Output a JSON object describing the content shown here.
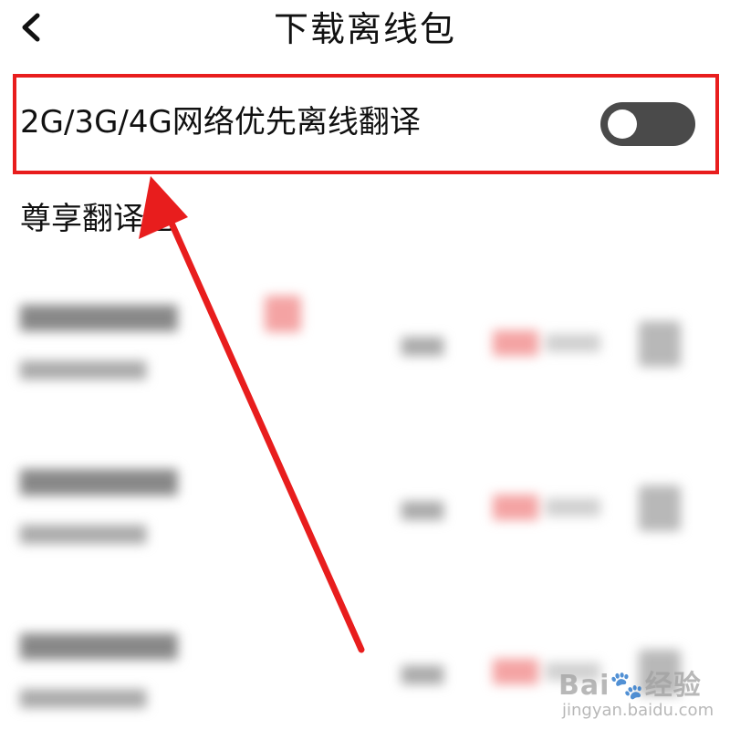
{
  "header": {
    "title": "下载离线包",
    "back_icon": "chevron-left-icon"
  },
  "offline_setting": {
    "label": "2G/3G/4G网络优先离线翻译",
    "toggle_on": false,
    "toggle_icon": "toggle-switch"
  },
  "section": {
    "title": "尊享翻译包"
  },
  "annotation": {
    "highlight_color": "#e81d1d",
    "arrow_color": "#e81d1d"
  },
  "packages": [
    {
      "name": "",
      "subtitle": ""
    },
    {
      "name": "",
      "subtitle": ""
    },
    {
      "name": "",
      "subtitle": ""
    }
  ],
  "watermark": {
    "brand": "Bai",
    "brand_suffix": "经验",
    "url": "jingyan.baidu.com"
  }
}
